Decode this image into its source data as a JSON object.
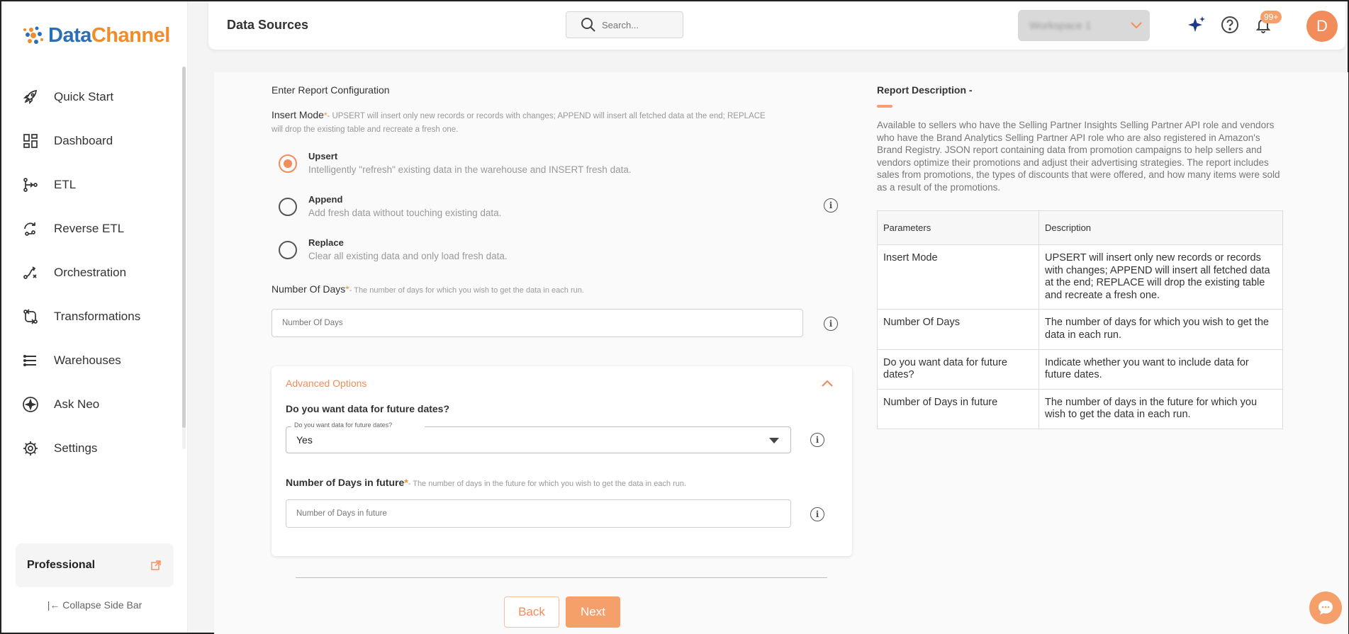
{
  "brand": {
    "name_part1": "Data",
    "name_part2": "Channel"
  },
  "sidebar": {
    "items": [
      {
        "label": "Quick Start",
        "icon": "rocket-icon"
      },
      {
        "label": "Dashboard",
        "icon": "grid-icon"
      },
      {
        "label": "ETL",
        "icon": "etl-icon"
      },
      {
        "label": "Reverse ETL",
        "icon": "reverse-etl-icon"
      },
      {
        "label": "Orchestration",
        "icon": "orchestration-icon"
      },
      {
        "label": "Transformations",
        "icon": "transformations-icon"
      },
      {
        "label": "Warehouses",
        "icon": "warehouse-icon"
      },
      {
        "label": "Ask Neo",
        "icon": "sparkle-icon"
      },
      {
        "label": "Settings",
        "icon": "gear-icon"
      }
    ],
    "plan": "Professional",
    "collapse_label": "Collapse Side Bar"
  },
  "header": {
    "title": "Data Sources",
    "search_placeholder": "Search...",
    "workspace_label": "Workspace 1",
    "notifications_badge": "99+",
    "avatar_initial": "D"
  },
  "form": {
    "section_title": "Enter Report Configuration",
    "insert_mode": {
      "label": "Insert Mode",
      "required_mark": "*",
      "note": "- UPSERT will insert only new records or records with changes; APPEND will insert all fetched data at the end; REPLACE will drop the existing table and recreate a fresh one.",
      "options": [
        {
          "title": "Upsert",
          "desc": "Intelligently \"refresh\" existing data in the warehouse and INSERT fresh data.",
          "selected": true
        },
        {
          "title": "Append",
          "desc": "Add fresh data without touching existing data.",
          "selected": false
        },
        {
          "title": "Replace",
          "desc": "Clear all existing data and only load fresh data.",
          "selected": false
        }
      ]
    },
    "number_of_days": {
      "label": "Number Of Days",
      "required_mark": "*",
      "note": "- The number of days for which you wish to get the data in each run.",
      "placeholder": "Number Of Days"
    },
    "advanced": {
      "title": "Advanced Options",
      "future_dates_question": "Do you want data for future dates?",
      "future_dates_legend": "Do you want data for future dates?",
      "future_dates_value": "Yes",
      "days_in_future_label": "Number of Days in future",
      "days_in_future_required": "*",
      "days_in_future_note": "- The number of days in the future for which you wish to get the data in each run.",
      "days_in_future_placeholder": "Number of Days in future"
    },
    "back_label": "Back",
    "next_label": "Next"
  },
  "report": {
    "title": "Report Description -",
    "description": "Available to sellers who have the Selling Partner Insights Selling Partner API role and vendors who have the Brand Analytics Selling Partner API role who are also registered in Amazon's Brand Registry. JSON report containing data from promotion campaigns to help sellers and vendors optimize their promotions and adjust their advertising strategies. The report includes sales from promotions, the types of discounts that were offered, and how many items were sold as a result of the promotions.",
    "table_headers": [
      "Parameters",
      "Description"
    ],
    "rows": [
      [
        "Insert Mode",
        "UPSERT will insert only new records or records with changes; APPEND will insert all fetched data at the end; REPLACE will drop the existing table and recreate a fresh one."
      ],
      [
        "Number Of Days",
        "The number of days for which you wish to get the data in each run."
      ],
      [
        "Do you want data for future dates?",
        "Indicate whether you want to include data for future dates."
      ],
      [
        "Number of Days in future",
        "The number of days in the future for which you wish to get the data in each run."
      ]
    ]
  },
  "colors": {
    "accent": "#f28c5a",
    "brand_blue": "#2a6fb3",
    "brand_orange": "#f28c28"
  }
}
